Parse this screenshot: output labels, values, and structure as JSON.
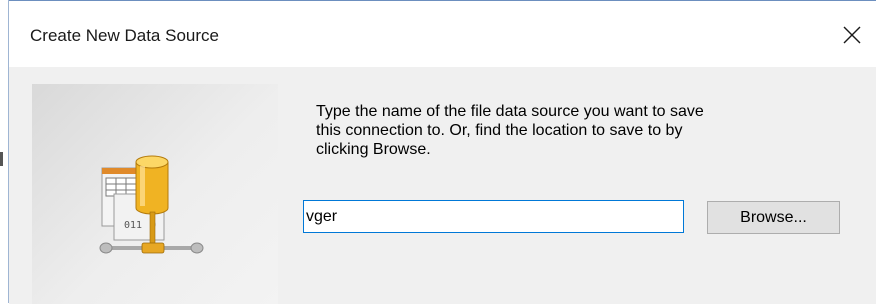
{
  "window": {
    "title": "Create New Data Source",
    "close_glyph": "✕"
  },
  "instructions": {
    "lines": [
      "Type the name of the file data source you want to save",
      "this connection to.  Or, find the location to save to by",
      "clicking Browse."
    ]
  },
  "file_name_input": {
    "value": "vger"
  },
  "browse_button": {
    "label": "Browse..."
  },
  "illustration": {
    "icon": "data-source-file-icon",
    "file_text": [
      "0",
      "011",
      "0"
    ]
  },
  "colors": {
    "content_bg": "#f0f0f0",
    "input_border_focus": "#0078d7",
    "button_bg": "#e1e1e1",
    "cylinder_gold": "#f0b323"
  }
}
